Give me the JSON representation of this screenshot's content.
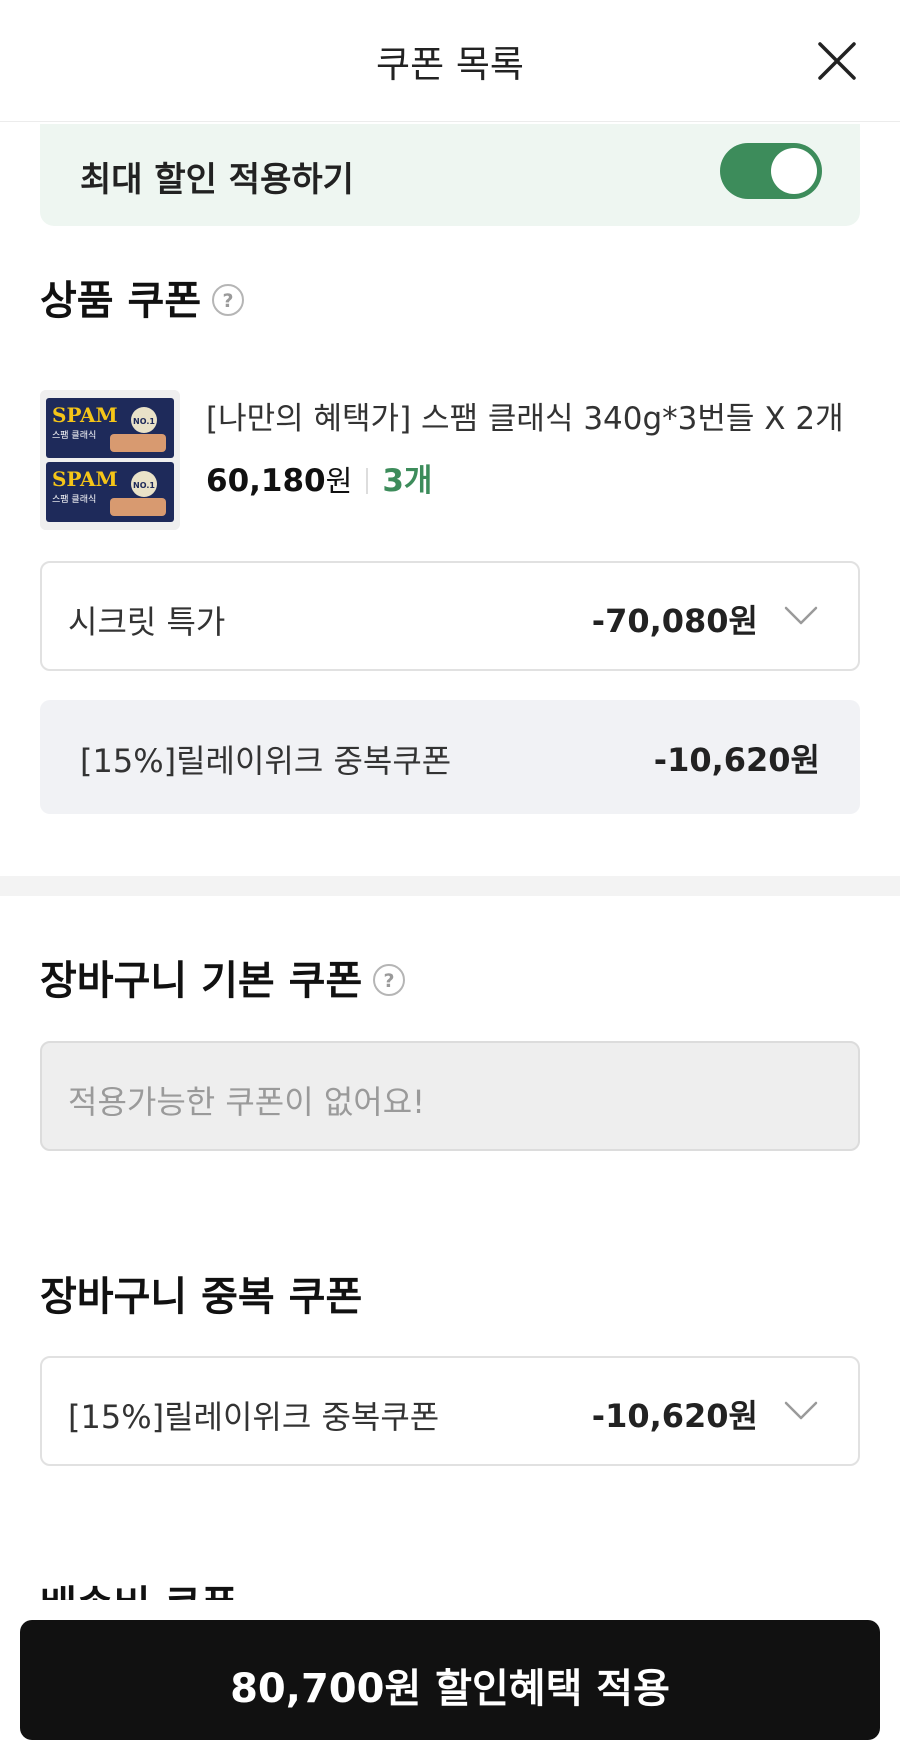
{
  "header": {
    "title": "쿠폰 목록",
    "close_icon": "close-icon"
  },
  "max_discount": {
    "label": "최대 할인 적용하기",
    "enabled": true,
    "toggle_color": "#3d8c5b"
  },
  "product_coupon": {
    "title": "상품 쿠폰",
    "help_icon": "question-circle-icon",
    "product": {
      "name": "[나만의 혜택가] 스팸 클래식 340g*3번들 X 2개",
      "price": "60,180",
      "price_unit": "원",
      "quantity": "3개",
      "thumbnail_texts": [
        "SPAM",
        "스팸 클래식",
        "NO.1"
      ]
    },
    "selected_coupon": {
      "label": "시크릿 특가",
      "amount": "-70,080원"
    },
    "applied_coupon": {
      "label": "[15%]릴레이위크 중복쿠폰",
      "amount": "-10,620원"
    }
  },
  "cart_basic_coupon": {
    "title": "장바구니 기본 쿠폰",
    "help_icon": "question-circle-icon",
    "empty_message": "적용가능한 쿠폰이 없어요!"
  },
  "cart_duplicate_coupon": {
    "title": "장바구니 중복 쿠폰",
    "selected_coupon": {
      "label": "[15%]릴레이위크 중복쿠폰",
      "amount": "-10,620원"
    }
  },
  "shipping_coupon": {
    "title": "배송비 쿠폰"
  },
  "apply_button": {
    "label": "80,700원 할인혜택 적용"
  },
  "colors": {
    "accent_green": "#3d8c5b",
    "highlight_bg": "#eef6f1",
    "button_bg": "#111111"
  }
}
